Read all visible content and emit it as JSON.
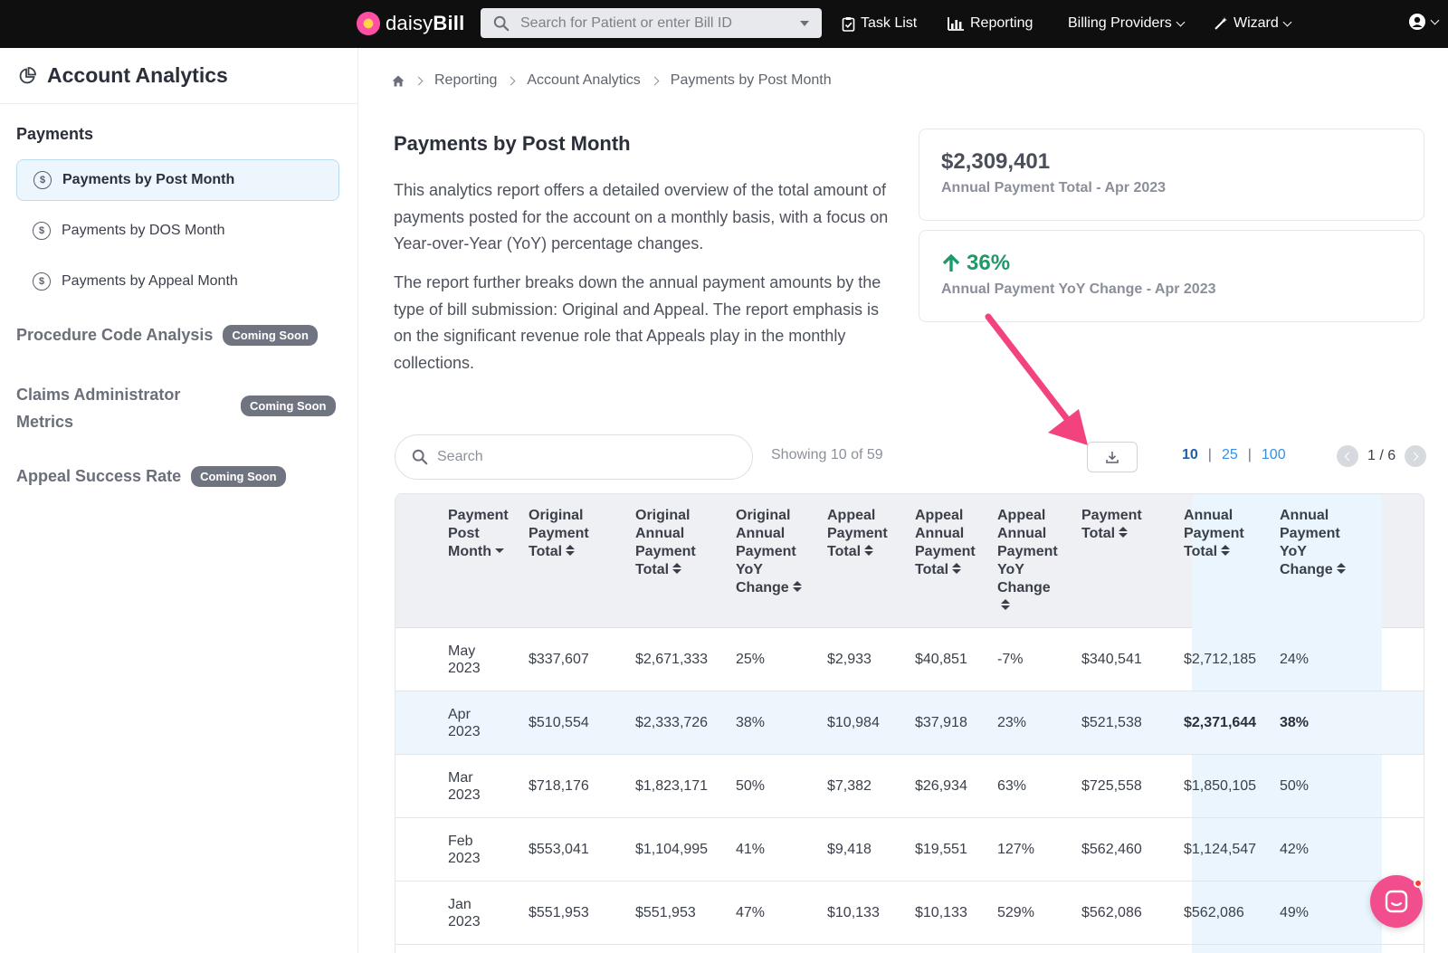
{
  "topbar": {
    "logo_light": "daisy",
    "logo_bold": "Bill",
    "search_placeholder": "Search for Patient or enter Bill ID",
    "nav": {
      "task_list": "Task List",
      "reporting": "Reporting",
      "billing_providers": "Billing Providers",
      "wizard": "Wizard"
    }
  },
  "sidebar": {
    "title": "Account Analytics",
    "payments_section": "Payments",
    "payment_links": [
      "Payments by Post Month",
      "Payments by DOS Month",
      "Payments by Appeal Month"
    ],
    "procedure_code": "Procedure Code Analysis",
    "claims_admin_line1": "Claims Administrator",
    "claims_admin_line2": "Metrics",
    "appeal_success": "Appeal Success Rate",
    "coming_soon": "Coming Soon"
  },
  "breadcrumb": [
    "Reporting",
    "Account Analytics",
    "Payments by Post Month"
  ],
  "page": {
    "title": "Payments by Post Month",
    "para1": "This analytics report offers a detailed overview of the total amount of payments posted for the account on a monthly basis, with a focus on Year-over-Year (YoY) percentage changes.",
    "para2": "The report further breaks down the annual payment amounts by the type of bill submission: Original and Appeal. The report emphasis is on the significant revenue role that Appeals play in the monthly collections."
  },
  "summary": {
    "total_value": "$2,309,401",
    "total_label": "Annual Payment Total - Apr 2023",
    "yoy_value": "36%",
    "yoy_label": "Annual Payment YoY Change - Apr 2023"
  },
  "controls": {
    "search_placeholder": "Search",
    "showing": "Showing 10 of 59",
    "page_sizes": [
      "10",
      "25",
      "100"
    ],
    "page_indicator": "1 / 6"
  },
  "table": {
    "headers": [
      [
        "Payment",
        "Post",
        "Month"
      ],
      [
        "Original",
        "Payment",
        "Total"
      ],
      [
        "Original",
        "Annual",
        "Payment",
        "Total"
      ],
      [
        "Original",
        "Annual",
        "Payment",
        "YoY",
        "Change"
      ],
      [
        "Appeal",
        "Payment",
        "Total"
      ],
      [
        "Appeal",
        "Annual",
        "Payment",
        "Total"
      ],
      [
        "Appeal",
        "Annual",
        "Payment",
        "YoY",
        "Change"
      ],
      [
        "Payment",
        "Total"
      ],
      [
        "Annual",
        "Payment",
        "Total"
      ],
      [
        "Annual",
        "Payment",
        "YoY",
        "Change"
      ]
    ],
    "rows": [
      {
        "month_1": "May",
        "month_2": "2023",
        "c1": "$337,607",
        "c2": "$2,671,333",
        "c3": "25%",
        "c4": "$2,933",
        "c5": "$40,851",
        "c6": "-7%",
        "c7": "$340,541",
        "c8": "$2,712,185",
        "c9": "24%"
      },
      {
        "month_1": "Apr",
        "month_2": "2023",
        "c1": "$510,554",
        "c2": "$2,333,726",
        "c3": "38%",
        "c4": "$10,984",
        "c5": "$37,918",
        "c6": "23%",
        "c7": "$521,538",
        "c8": "$2,371,644",
        "c9": "38%"
      },
      {
        "month_1": "Mar",
        "month_2": "2023",
        "c1": "$718,176",
        "c2": "$1,823,171",
        "c3": "50%",
        "c4": "$7,382",
        "c5": "$26,934",
        "c6": "63%",
        "c7": "$725,558",
        "c8": "$1,850,105",
        "c9": "50%"
      },
      {
        "month_1": "Feb",
        "month_2": "2023",
        "c1": "$553,041",
        "c2": "$1,104,995",
        "c3": "41%",
        "c4": "$9,418",
        "c5": "$19,551",
        "c6": "127%",
        "c7": "$562,460",
        "c8": "$1,124,547",
        "c9": "42%"
      },
      {
        "month_1": "Jan",
        "month_2": "2023",
        "c1": "$551,953",
        "c2": "$551,953",
        "c3": "47%",
        "c4": "$10,133",
        "c5": "$10,133",
        "c6": "529%",
        "c7": "$562,086",
        "c8": "$562,086",
        "c9": "49%"
      }
    ]
  },
  "colors": {
    "accent_pink": "#f24d8d",
    "positive_green": "#1e9a6a",
    "link_blue": "#3a8fe0",
    "highlight_column": "#eaf5fd"
  }
}
